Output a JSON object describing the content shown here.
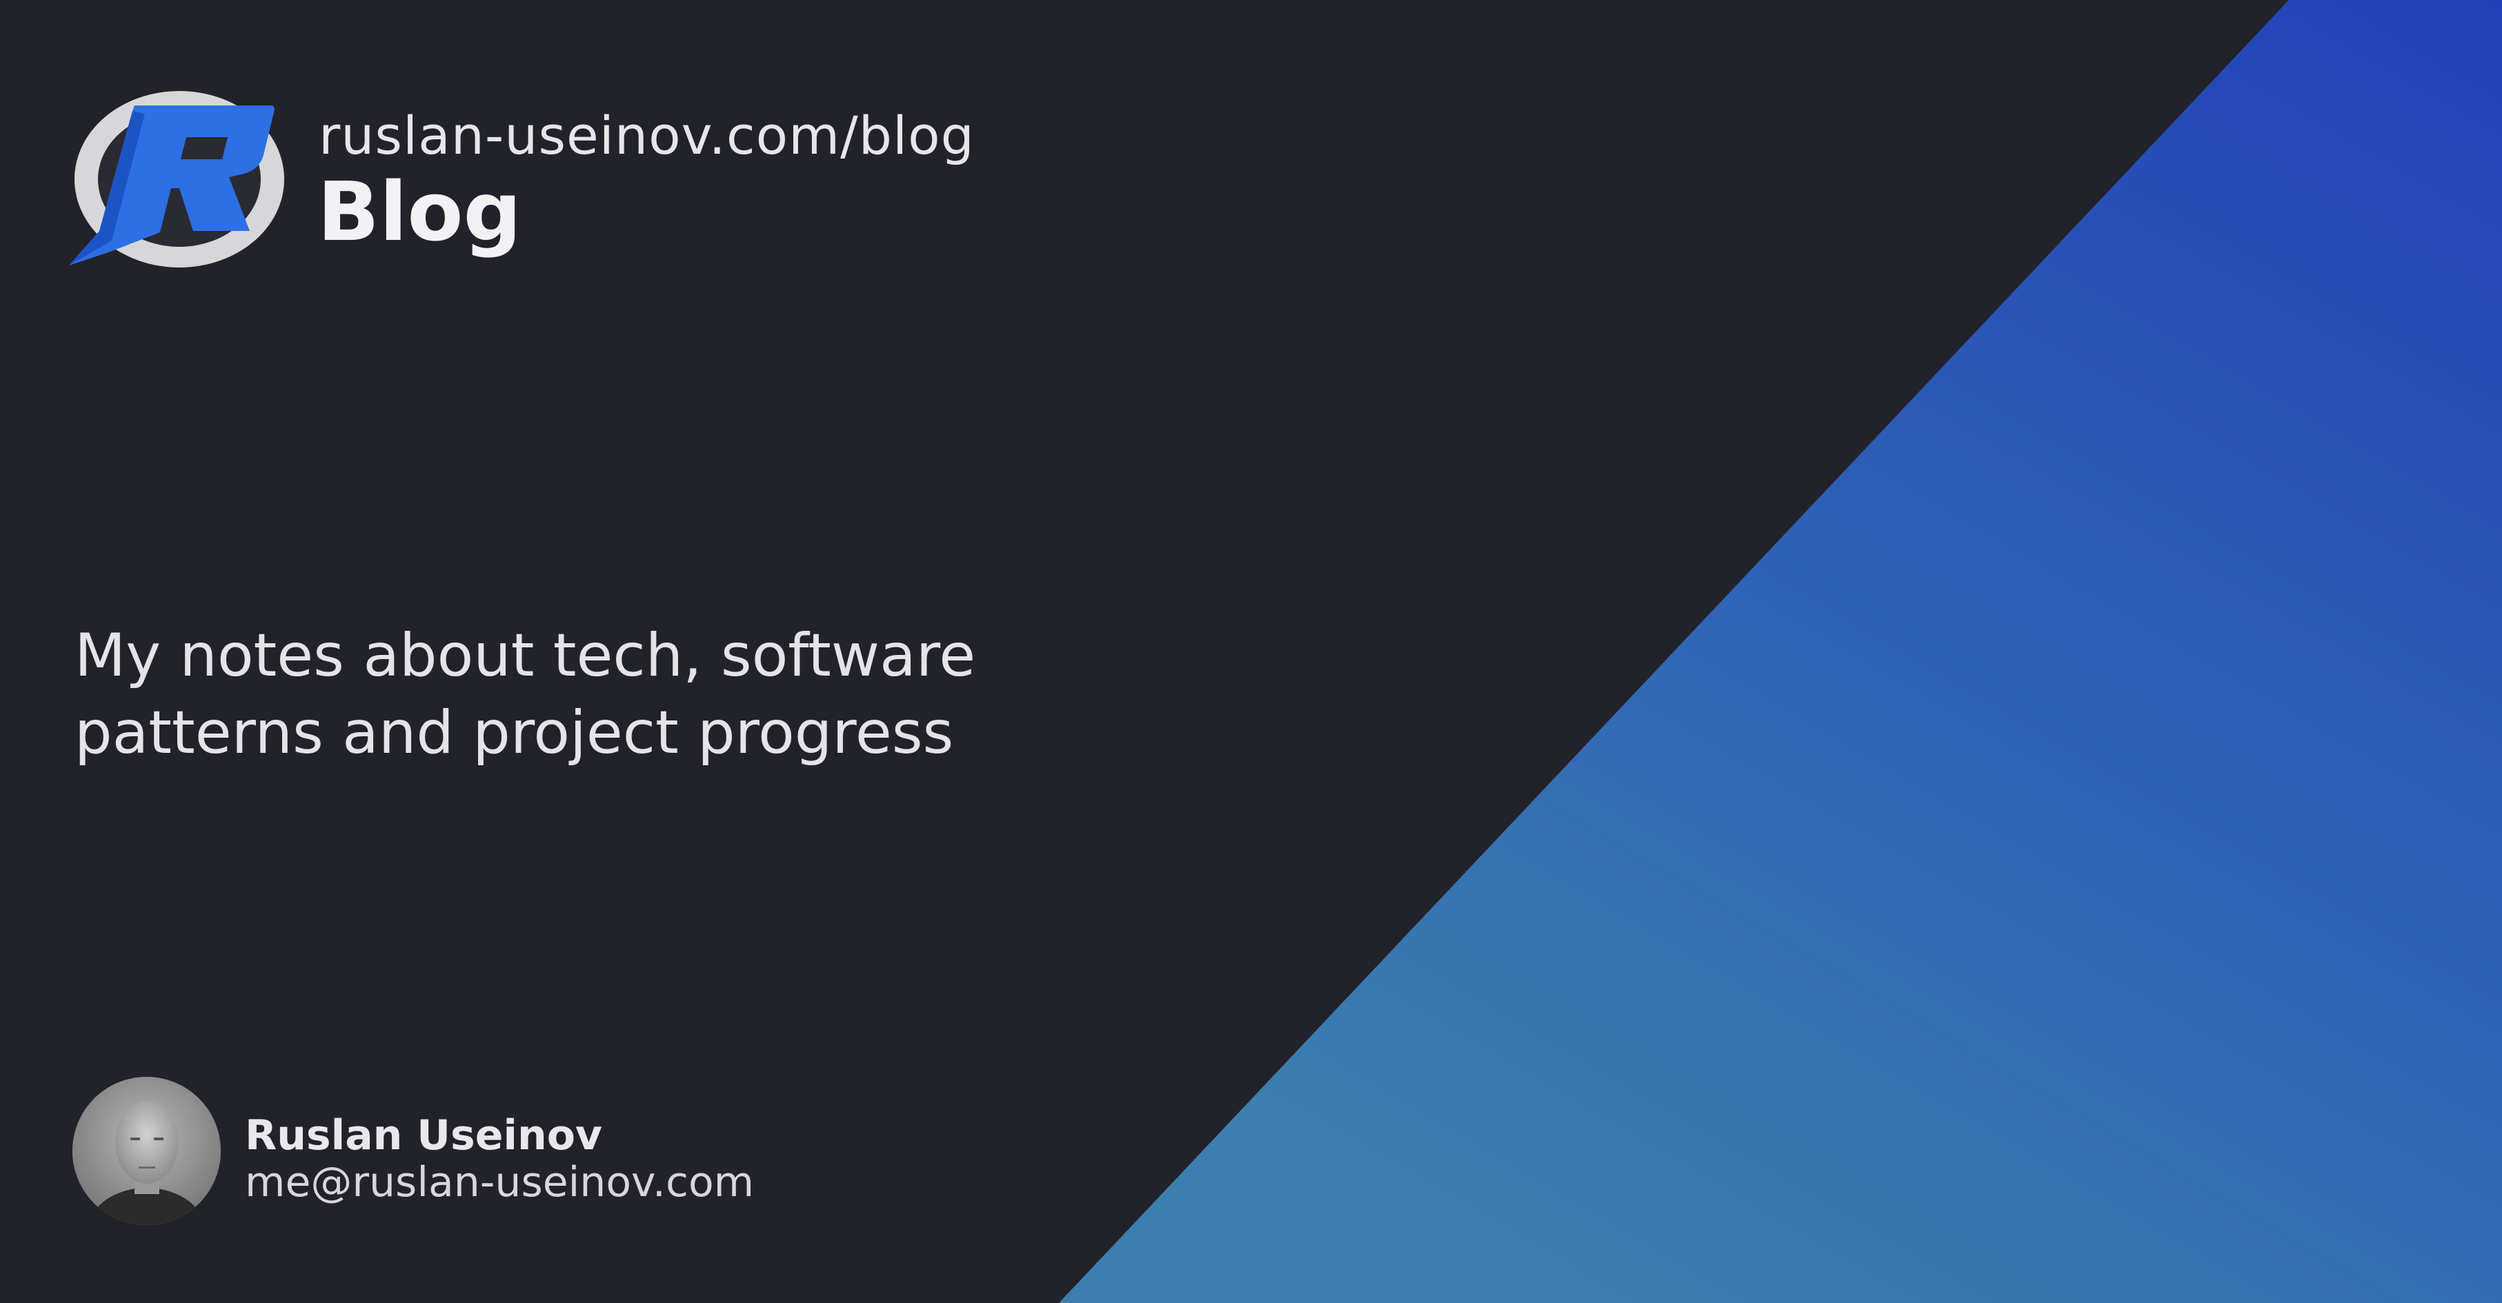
{
  "header": {
    "url": "ruslan-useinov.com/blog",
    "title": "Blog"
  },
  "tagline": {
    "line1": "My notes about tech, software",
    "line2": "patterns and project progress"
  },
  "author": {
    "name": "Ruslan Useinov",
    "email": "me@ruslan-useinov.com"
  },
  "colors": {
    "background": "#22222a",
    "accent_top": "#2244b8",
    "accent_bottom": "#3a78b0",
    "logo_blue": "#2b6fe0",
    "logo_ring": "#d9d9dc"
  }
}
